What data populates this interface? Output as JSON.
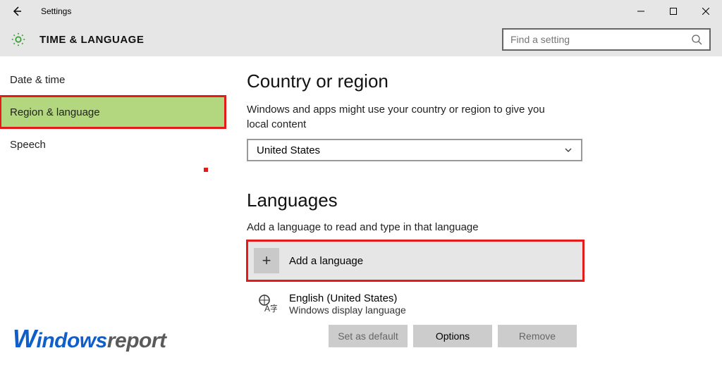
{
  "titlebar": {
    "title": "Settings"
  },
  "header": {
    "section_title": "TIME & LANGUAGE",
    "search_placeholder": "Find a setting"
  },
  "sidebar": {
    "items": [
      {
        "label": "Date & time",
        "selected": false
      },
      {
        "label": "Region & language",
        "selected": true
      },
      {
        "label": "Speech",
        "selected": false
      }
    ]
  },
  "content": {
    "country_heading": "Country or region",
    "country_desc": "Windows and apps might use your country or region to give you local content",
    "country_value": "United States",
    "languages_heading": "Languages",
    "languages_desc": "Add a language to read and type in that language",
    "add_language_label": "Add a language",
    "language_item": {
      "name": "English (United States)",
      "subtitle": "Windows display language"
    },
    "buttons": {
      "set_default": "Set as default",
      "options": "Options",
      "remove": "Remove"
    }
  },
  "watermark": {
    "w": "W",
    "indows": "indows",
    "report": "report"
  }
}
